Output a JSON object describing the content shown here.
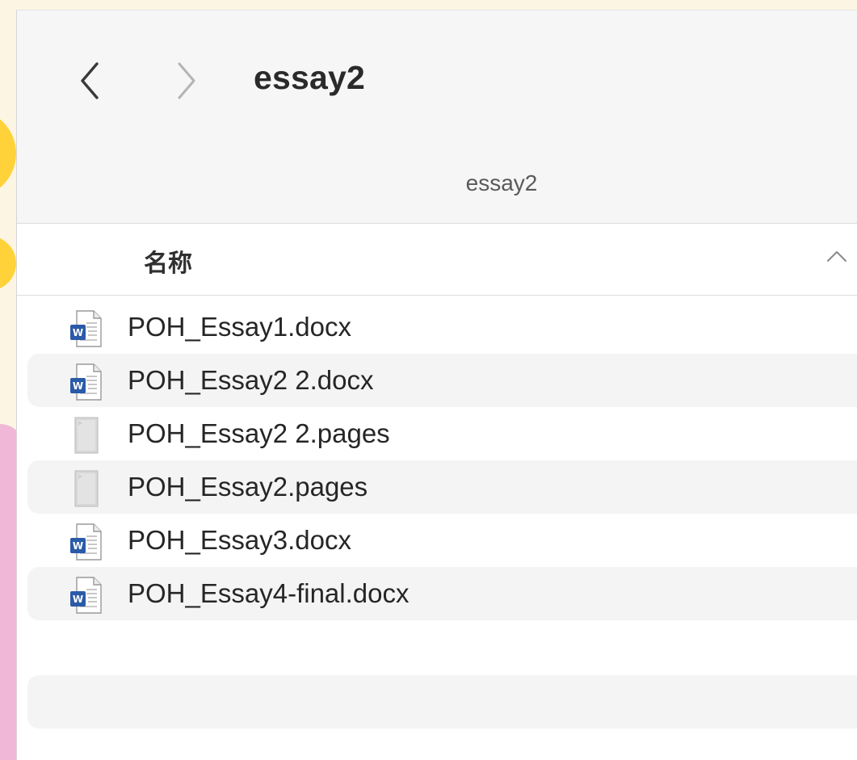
{
  "window": {
    "title": "essay2",
    "path_title": "essay2"
  },
  "toolbar": {
    "back_icon": "chevron-left-icon",
    "forward_icon": "chevron-right-icon"
  },
  "column_header": {
    "name_label": "名称",
    "sort_icon": "chevron-up-icon"
  },
  "files": [
    {
      "name": "POH_Essay1.docx",
      "icon": "word-document-icon"
    },
    {
      "name": "POH_Essay2 2.docx",
      "icon": "word-document-icon"
    },
    {
      "name": "POH_Essay2 2.pages",
      "icon": "pages-document-icon"
    },
    {
      "name": "POH_Essay2.pages",
      "icon": "pages-document-icon"
    },
    {
      "name": "POH_Essay3.docx",
      "icon": "word-document-icon"
    },
    {
      "name": "POH_Essay4-final.docx",
      "icon": "word-document-icon"
    }
  ],
  "colors": {
    "word_blue": "#2b5aa8",
    "wallpaper_yellow": "#ffd23a",
    "wallpaper_pink": "#f0b8d6"
  }
}
